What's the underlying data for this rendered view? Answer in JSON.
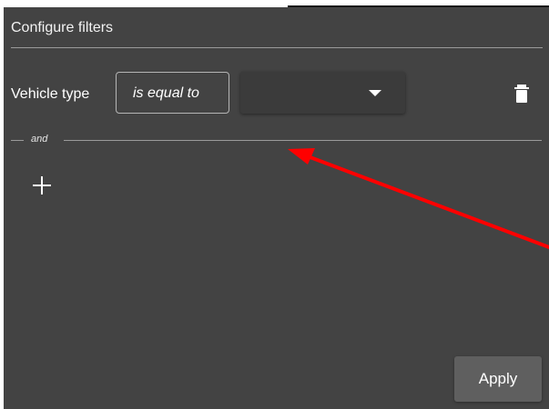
{
  "panel": {
    "title": "Configure filters"
  },
  "filter": {
    "field_label": "Vehicle type",
    "operator": "is equal to",
    "value": "",
    "value_icon": "caret-down-icon",
    "delete_icon": "trash-icon"
  },
  "connector": {
    "label": "and"
  },
  "add_filter": {
    "icon": "plus-icon"
  },
  "footer": {
    "apply_label": "Apply"
  },
  "annotation": {
    "color": "#ff0000"
  }
}
